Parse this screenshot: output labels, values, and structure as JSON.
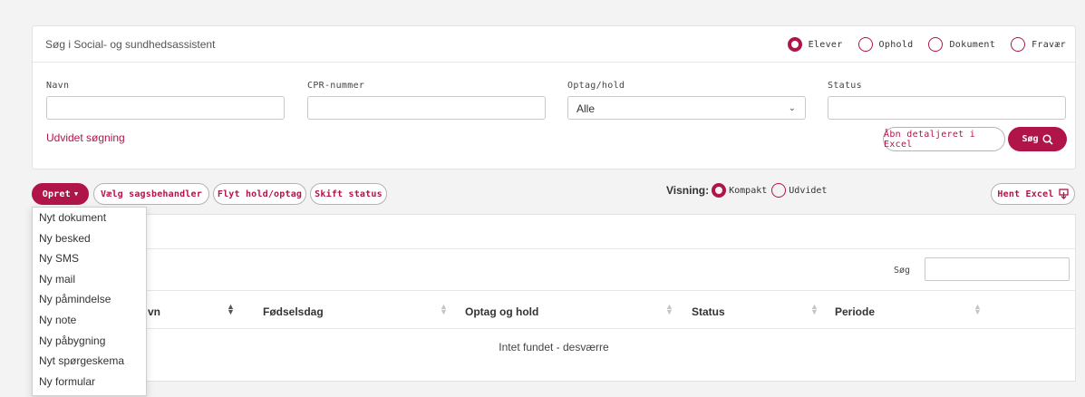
{
  "search": {
    "title": "Søg i Social- og sundhedsassistent",
    "types": [
      {
        "label": "Elever",
        "checked": true
      },
      {
        "label": "Ophold",
        "checked": false
      },
      {
        "label": "Dokument",
        "checked": false
      },
      {
        "label": "Fravær",
        "checked": false
      }
    ],
    "fields": {
      "navn_label": "Navn",
      "cpr_label": "CPR-nummer",
      "optag_label": "Optag/hold",
      "optag_value": "Alle",
      "status_label": "Status"
    },
    "advanced_link": "Udvidet søgning",
    "excel_button": "Åbn detaljeret i Excel",
    "search_button": "Søg"
  },
  "toolbar": {
    "create": "Opret",
    "assign": "Vælg sagsbehandler",
    "move": "Flyt hold/optag",
    "status": "Skift status",
    "view_label": "Visning:",
    "view_compact": "Kompakt",
    "view_extended": "Udvidet",
    "export": "Hent Excel"
  },
  "create_menu": [
    "Nyt dokument",
    "Ny besked",
    "Ny SMS",
    "Ny mail",
    "Ny påmindelse",
    "Ny note",
    "Ny påbygning",
    "Nyt spørgeskema",
    "Ny formular"
  ],
  "table": {
    "search_label": "Søg",
    "columns": [
      "vn",
      "Fødselsdag",
      "Optag og hold",
      "Status",
      "Periode"
    ],
    "empty": "Intet fundet - desværre"
  },
  "colors": {
    "accent": "#b0154a"
  }
}
